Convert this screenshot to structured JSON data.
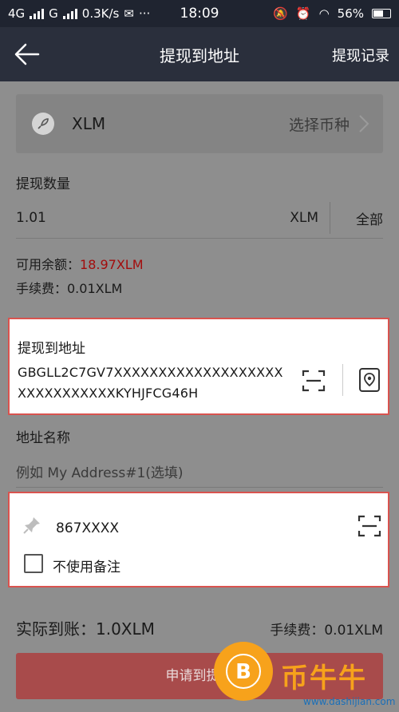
{
  "status_bar": {
    "left": "4G",
    "network2": "G",
    "speed": "0.3K/s",
    "dots": "···",
    "time": "18:09",
    "battery": "56%"
  },
  "nav": {
    "title": "提现到地址",
    "records": "提现记录"
  },
  "coin": {
    "name": "XLM",
    "choose": "选择币种"
  },
  "amount": {
    "label": "提现数量",
    "value": "1.01",
    "unit": "XLM",
    "all": "全部"
  },
  "balance": {
    "available_label": "可用余额：",
    "available_value": "18.97XLM",
    "fee_text": "手续费：0.01XLM"
  },
  "address": {
    "label": "提现到地址",
    "value": "GBGLL2C7GV7XXXXXXXXXXXXXXXXXXXXXXXXXXXXXXKYHJFCG46H"
  },
  "address_name": {
    "label": "地址名称",
    "placeholder": "例如 My Address#1(选填)"
  },
  "memo": {
    "value": "867XXXX",
    "checkbox_label": "不使用备注"
  },
  "summary": {
    "actual": "实际到账：1.0XLM",
    "fee": "手续费：0.01XLM"
  },
  "submit": {
    "label": "申请到提现"
  },
  "watermark": {
    "text": "币牛牛",
    "site": "www.dashijian.com"
  },
  "colors": {
    "highlight_border": "#d9534f",
    "balance_red": "#a30d0d",
    "submit_bg": "#a84b4b",
    "nav_bg": "#2a2f3c"
  }
}
